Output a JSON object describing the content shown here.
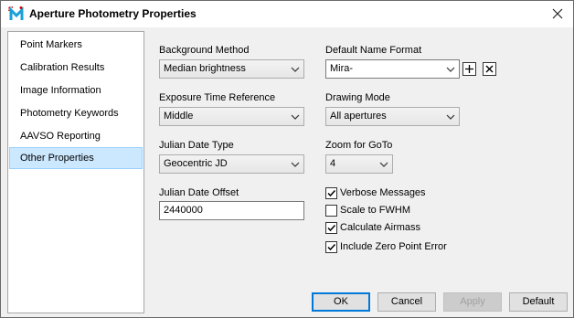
{
  "window": {
    "title": "Aperture Photometry Properties",
    "app_icon": "aperture-m-icon",
    "close_icon": "close-icon"
  },
  "nav": {
    "items": [
      {
        "label": "Point Markers",
        "selected": false
      },
      {
        "label": "Calibration Results",
        "selected": false
      },
      {
        "label": "Image Information",
        "selected": false
      },
      {
        "label": "Photometry Keywords",
        "selected": false
      },
      {
        "label": "AAVSO Reporting",
        "selected": false
      },
      {
        "label": "Other Properties",
        "selected": true
      }
    ],
    "selection_color": "#cce8ff"
  },
  "left": {
    "background_method_label": "Background Method",
    "background_method_value": "Median brightness",
    "exposure_label": "Exposure Time Reference",
    "exposure_value": "Middle",
    "jd_type_label": "Julian Date Type",
    "jd_type_value": "Geocentric JD",
    "jd_offset_label": "Julian Date Offset",
    "jd_offset_value": "2440000"
  },
  "right": {
    "name_format_label": "Default Name Format",
    "name_format_value": "Mira-",
    "add_icon": "plus-icon",
    "remove_icon": "x-icon",
    "drawing_mode_label": "Drawing Mode",
    "drawing_mode_value": "All apertures",
    "zoom_label": "Zoom for GoTo",
    "zoom_value": "4",
    "checks": [
      {
        "label": "Verbose Messages",
        "checked": true
      },
      {
        "label": "Scale to FWHM",
        "checked": false
      },
      {
        "label": "Calculate Airmass",
        "checked": true
      },
      {
        "label": "Include Zero Point Error",
        "checked": true
      }
    ]
  },
  "buttons": {
    "ok": "OK",
    "cancel": "Cancel",
    "apply": "Apply",
    "default": "Default"
  },
  "colors": {
    "accent": "#0078d7",
    "window_bg": "#f0f0f0"
  }
}
